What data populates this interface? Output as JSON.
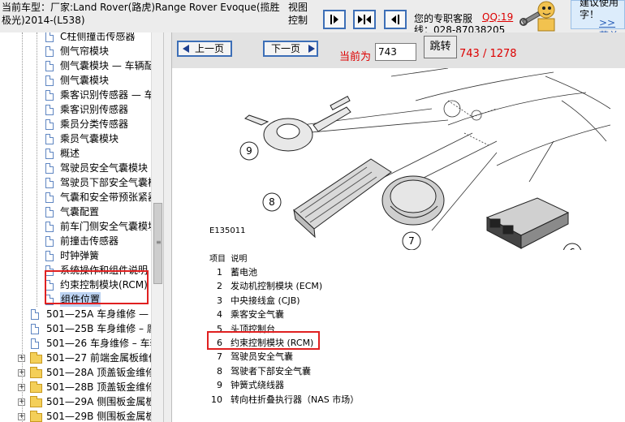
{
  "header": {
    "vehicle_title": "当前车型：厂家:Land Rover(路虎)Range Rover Evoque(揽胜极光)2014-(L538)",
    "view_control": "视图控制",
    "customer_service": "您的专职客服",
    "qq": "QQ:19",
    "phone": "线：028-87038205",
    "promo_text": "建议使用\n字！",
    "promo_link": ">>菜单"
  },
  "sidebar": {
    "items": [
      {
        "label": "C柱侧撞击传感器",
        "type": "doc"
      },
      {
        "label": "侧气帘模块",
        "type": "doc"
      },
      {
        "label": "侧气囊模块 — 车辆配备",
        "type": "doc"
      },
      {
        "label": "侧气囊模块",
        "type": "doc"
      },
      {
        "label": "乘客识别传感器 — 车辆",
        "type": "doc"
      },
      {
        "label": "乘客识别传感器",
        "type": "doc"
      },
      {
        "label": "乘员分类传感器",
        "type": "doc"
      },
      {
        "label": "乘员气囊模块",
        "type": "doc"
      },
      {
        "label": "概述",
        "type": "doc"
      },
      {
        "label": "驾驶员安全气囊模块",
        "type": "doc"
      },
      {
        "label": "驾驶员下部安全气囊模块",
        "type": "doc"
      },
      {
        "label": "气囊和安全带预张紧器",
        "type": "doc"
      },
      {
        "label": "气囊配置",
        "type": "doc"
      },
      {
        "label": "前车门侧安全气囊模块",
        "type": "doc"
      },
      {
        "label": "前撞击传感器",
        "type": "doc"
      },
      {
        "label": "时钟弹簧",
        "type": "doc"
      },
      {
        "label": "系统操作和组件说明",
        "type": "doc"
      },
      {
        "label": "约束控制模块(RCM)",
        "type": "doc"
      },
      {
        "label": "组件位置",
        "type": "doc",
        "selected": true
      },
      {
        "label": "501—25A 车身维修 — 常",
        "type": "doc1"
      },
      {
        "label": "501—25B 车身维修 – 腐",
        "type": "doc1"
      },
      {
        "label": "501—26 车身维修 – 车辆",
        "type": "doc1"
      },
      {
        "label": "501—27 前端金属板维修",
        "type": "folder"
      },
      {
        "label": "501—28A 顶盖钣金维修",
        "type": "folder"
      },
      {
        "label": "501—28B 顶盖钣金维修",
        "type": "folder"
      },
      {
        "label": "501—29A 侧围板金属板",
        "type": "folder"
      },
      {
        "label": "501—29B 侧围板金属板",
        "type": "folder"
      }
    ]
  },
  "pager": {
    "prev_label": "上一页",
    "next_label": "下一页",
    "current_label": "当前为",
    "page_input": "743",
    "jump_label": "跳转",
    "page_count": "743 / 1278"
  },
  "figure": {
    "code": "E135011",
    "callouts": [
      "9",
      "8",
      "7",
      "6"
    ]
  },
  "legend": {
    "head_item": "项目",
    "head_desc": "说明",
    "rows": [
      {
        "num": "1",
        "text": "蓄电池"
      },
      {
        "num": "2",
        "text": "发动机控制模块 (ECM)"
      },
      {
        "num": "3",
        "text": "中央接线盒 (CJB)"
      },
      {
        "num": "4",
        "text": "乘客安全气囊"
      },
      {
        "num": "5",
        "text": "头顶控制台"
      },
      {
        "num": "6",
        "text": "约束控制模块 (RCM)"
      },
      {
        "num": "7",
        "text": "驾驶员安全气囊"
      },
      {
        "num": "8",
        "text": "驾驶者下部安全气囊"
      },
      {
        "num": "9",
        "text": "钟簧式绕线器"
      },
      {
        "num": "10",
        "text": "转向柱折叠执行器（NAS 市场）"
      }
    ]
  },
  "colors": {
    "highlight": "#e02020",
    "accent": "#3d6fb7",
    "pager_text": "#dd0000"
  }
}
